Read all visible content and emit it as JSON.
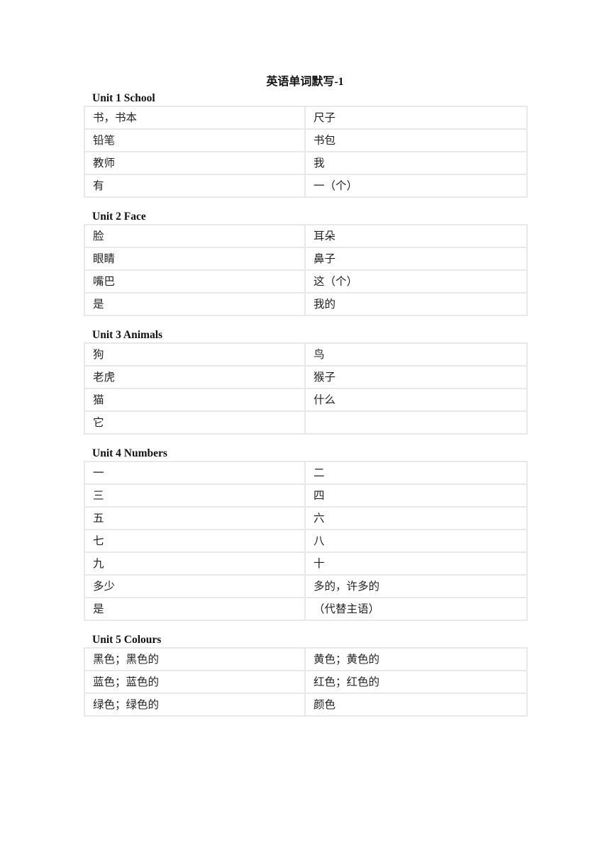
{
  "title": "英语单词默写-1",
  "units": [
    {
      "heading": "Unit 1 School",
      "rows": [
        [
          "书，书本",
          "尺子"
        ],
        [
          "铅笔",
          "书包"
        ],
        [
          "教师",
          "我"
        ],
        [
          "有",
          "一（个）"
        ]
      ]
    },
    {
      "heading": "Unit 2 Face",
      "rows": [
        [
          "脸",
          "耳朵"
        ],
        [
          "眼睛",
          "鼻子"
        ],
        [
          "嘴巴",
          "这（个）"
        ],
        [
          "是",
          "我的"
        ]
      ]
    },
    {
      "heading": "Unit 3 Animals",
      "rows": [
        [
          "狗",
          "鸟"
        ],
        [
          "老虎",
          "猴子"
        ],
        [
          "猫",
          "什么"
        ],
        [
          "它",
          ""
        ]
      ]
    },
    {
      "heading": "Unit 4 Numbers",
      "rows": [
        [
          "一",
          "二"
        ],
        [
          "三",
          "四"
        ],
        [
          "五",
          "六"
        ],
        [
          "七",
          "八"
        ],
        [
          "九",
          "十"
        ],
        [
          "多少",
          "多的，许多的"
        ],
        [
          "是",
          "（代替主语）"
        ]
      ]
    },
    {
      "heading": "Unit 5 Colours",
      "rows": [
        [
          "黑色；黑色的",
          "黄色；黄色的"
        ],
        [
          "蓝色；蓝色的",
          "红色；红色的"
        ],
        [
          "绿色；绿色的",
          "颜色"
        ]
      ]
    }
  ]
}
